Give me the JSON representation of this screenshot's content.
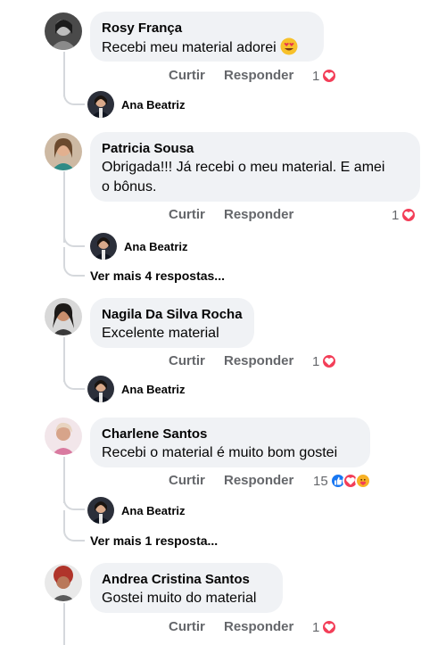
{
  "actions": {
    "like": "Curtir",
    "reply": "Responder"
  },
  "colors": {
    "heart": "#f33e58",
    "like": "#1877f2",
    "care": "#f7b125",
    "bubble": "#f0f2f5",
    "meta": "#65676b"
  },
  "comments": [
    {
      "author": "Rosy França",
      "text": "Recebi meu material adorei",
      "emoji": "heart-eyes-emoji",
      "reaction_count": "1",
      "reactions": [
        "heart-icon"
      ],
      "reply_author": "Ana Beatriz"
    },
    {
      "author": "Patricia Sousa",
      "text_line1": "Obrigada!!! Já recebi o meu material. E amei",
      "text_line2": "o bônus.",
      "reaction_count": "1",
      "reactions": [
        "heart-icon"
      ],
      "reply_author": "Ana Beatriz",
      "more_replies": "Ver mais 4 respostas..."
    },
    {
      "author": "Nagila Da Silva Rocha",
      "text": "Excelente material",
      "reaction_count": "1",
      "reactions": [
        "heart-icon"
      ],
      "reply_author": "Ana Beatriz"
    },
    {
      "author": "Charlene Santos",
      "text": "Recebi o material é muito bom gostei",
      "reaction_count": "15",
      "reactions": [
        "like-icon",
        "heart-icon",
        "care-icon"
      ],
      "reply_author": "Ana Beatriz",
      "more_replies": "Ver mais 1 resposta..."
    },
    {
      "author": "Andrea Cristina Santos",
      "text": "Gostei muito do material",
      "reaction_count": "1",
      "reactions": [
        "heart-icon"
      ]
    }
  ]
}
